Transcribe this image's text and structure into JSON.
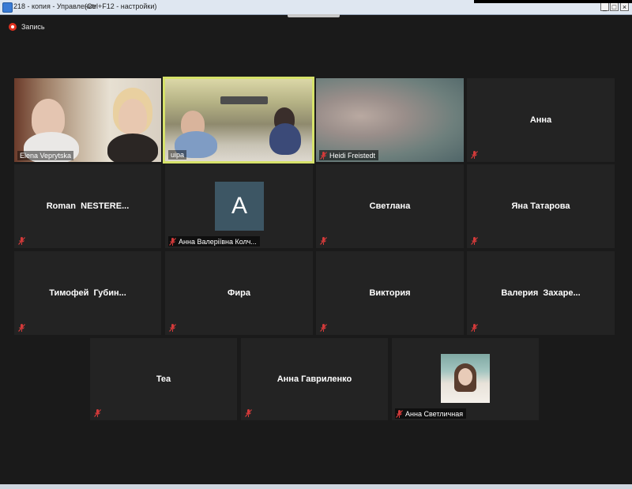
{
  "window": {
    "title": "218 - копия - Управление",
    "hint": "(Ctrl+F12 - настройки)",
    "controls": {
      "minimize": "_",
      "maximize": "□",
      "close": "×"
    }
  },
  "recording": {
    "label": "Запись"
  },
  "colors": {
    "background": "#1a1a1a",
    "tile": "#232323",
    "active_speaker_border": "#d6e26a",
    "recording": "#e0301e",
    "mute_icon": "#d33a3a",
    "avatar_bg": "#3d5664"
  },
  "participants": [
    {
      "name": "Elena Veprytska",
      "video": true,
      "muted": false
    },
    {
      "name": "uipa",
      "video": true,
      "muted": false,
      "active_speaker": true
    },
    {
      "name": "Heidi Freistedt",
      "video": true,
      "muted": true
    },
    {
      "name": "Анна",
      "video": false,
      "muted": true
    },
    {
      "name": "Roman  NESTERE...",
      "video": false,
      "muted": true
    },
    {
      "name": "Анна Валеріївна Колч...",
      "video": false,
      "muted": true,
      "avatar_letter": "A"
    },
    {
      "name": "Светлана",
      "video": false,
      "muted": true
    },
    {
      "name": "Яна Татарова",
      "video": false,
      "muted": true
    },
    {
      "name": "Тимофей  Губин...",
      "video": false,
      "muted": true
    },
    {
      "name": "Фира",
      "video": false,
      "muted": true
    },
    {
      "name": "Виктория",
      "video": false,
      "muted": true
    },
    {
      "name": "Валерия  Захаре...",
      "video": false,
      "muted": true
    },
    {
      "name": "Tea",
      "video": false,
      "muted": true
    },
    {
      "name": "Анна Гавриленко",
      "video": false,
      "muted": true
    },
    {
      "name": "Анна Светличная",
      "video": false,
      "muted": true,
      "profile_photo": true
    }
  ]
}
